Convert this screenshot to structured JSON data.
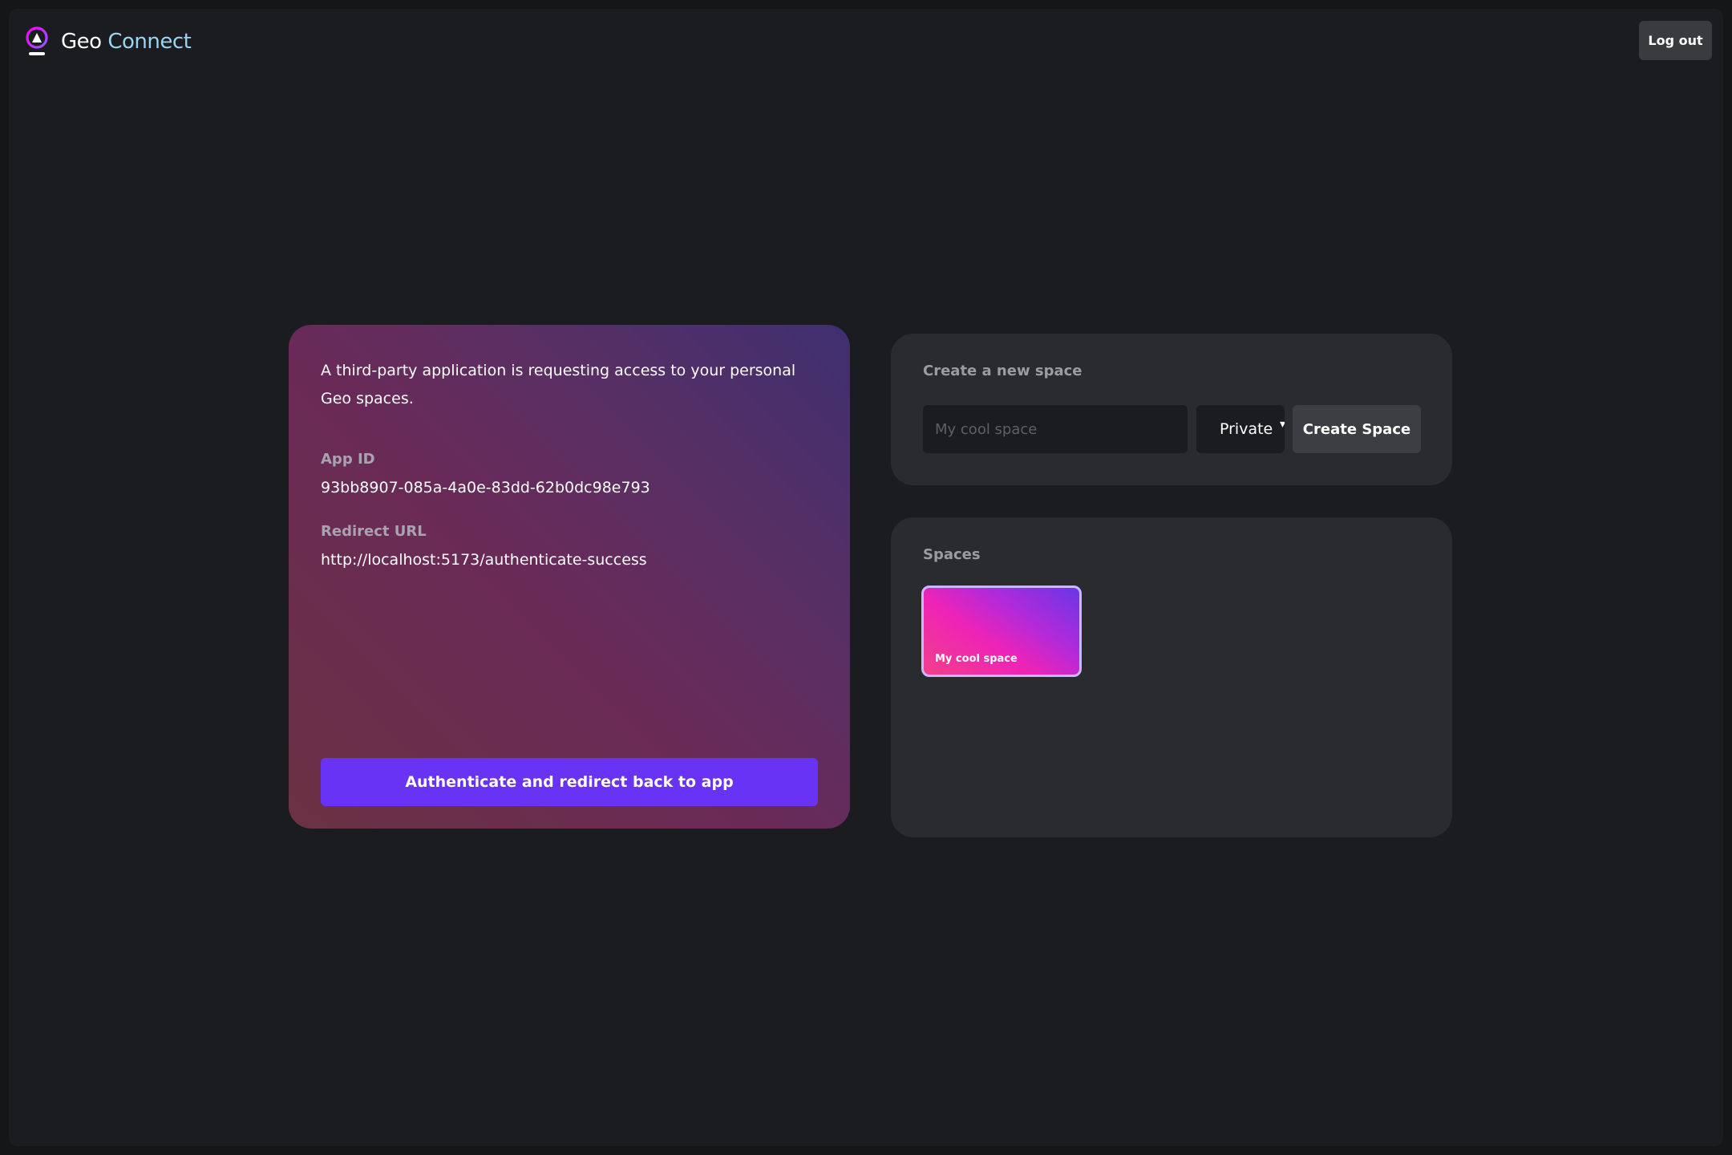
{
  "header": {
    "logo_icon": "geo-location-pin-icon",
    "logo_text_primary": "Geo",
    "logo_text_accent": "Connect",
    "logout_label": "Log out"
  },
  "auth": {
    "intro": "A third-party application is requesting access to your personal Geo spaces.",
    "app_id_label": "App ID",
    "app_id_value": "93bb8907-085a-4a0e-83dd-62b0dc98e793",
    "redirect_label": "Redirect URL",
    "redirect_value": "http://localhost:5173/authenticate-success",
    "button_label": "Authenticate and redirect back to app"
  },
  "create_space": {
    "title": "Create a new space",
    "input_placeholder": "My cool space",
    "input_value": "",
    "visibility_selected": "Private",
    "button_label": "Create Space"
  },
  "spaces": {
    "title": "Spaces",
    "items": [
      {
        "name": "My cool space"
      }
    ]
  },
  "colors": {
    "background": "#1b1c1f",
    "panel": "#2a2b2f",
    "primary_button": "#6833f5",
    "logo_accent": "#9ad4f5"
  }
}
